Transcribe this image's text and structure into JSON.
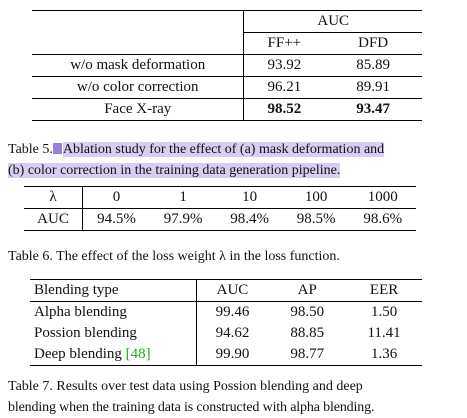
{
  "table5": {
    "header_group": "AUC",
    "col_ff": "FF++",
    "col_dfd": "DFD",
    "rows": [
      {
        "label": "w/o mask deformation",
        "ff": "93.92",
        "dfd": "85.89"
      },
      {
        "label": "w/o color correction",
        "ff": "96.21",
        "dfd": "89.91"
      },
      {
        "label": "Face X-ray",
        "ff": "98.52",
        "dfd": "93.47"
      }
    ],
    "caption_prefix": "Table 5.",
    "caption_line1": "Ablation study for the effect of (a) mask deformation and",
    "caption_line2": "(b) color correction in the training data generation pipeline."
  },
  "table6": {
    "lambda_label": "λ",
    "auc_label": "AUC",
    "lambdas": [
      "0",
      "1",
      "10",
      "100",
      "1000"
    ],
    "aucs": [
      "94.5%",
      "97.9%",
      "98.4%",
      "98.5%",
      "98.6%"
    ],
    "caption": "Table 6. The effect of the loss weight λ in the loss function."
  },
  "table7": {
    "headers": [
      "Blending type",
      "AUC",
      "AP",
      "EER"
    ],
    "rows": [
      {
        "name": "Alpha blending",
        "auc": "99.46",
        "ap": "98.50",
        "eer": "1.50"
      },
      {
        "name": "Possion blending",
        "auc": "94.62",
        "ap": "88.85",
        "eer": "11.41"
      },
      {
        "name": "Deep blending",
        "cite": "[48]",
        "auc": "99.90",
        "ap": "98.77",
        "eer": "1.36"
      }
    ],
    "caption_line1": "Table 7. Results over test data using Possion blending and deep",
    "caption_line2": "blending when the training data is constructed with alpha blending."
  }
}
